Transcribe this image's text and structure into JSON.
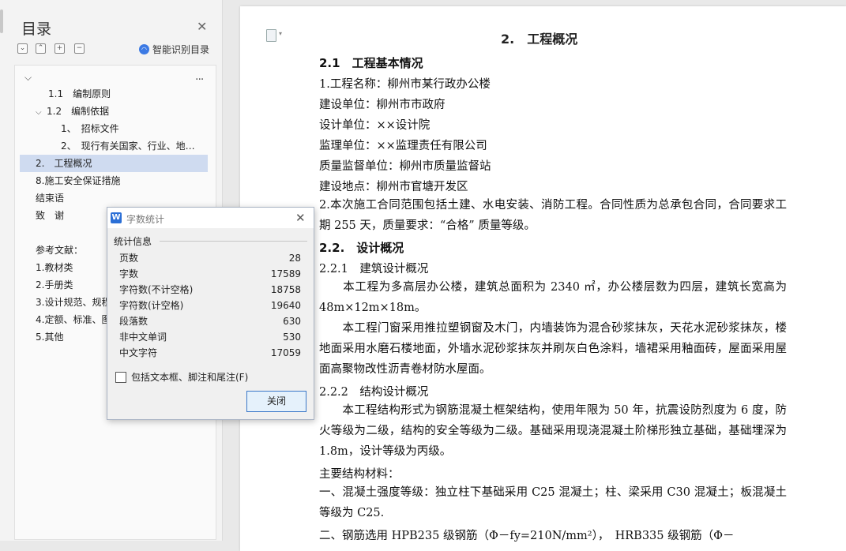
{
  "toc": {
    "title": "目录",
    "smart_label": "智能识别目录",
    "more": "...",
    "items": [
      {
        "label": "1.1　编制原则"
      },
      {
        "label": "1.2　编制依据"
      },
      {
        "label": "1、　招标文件"
      },
      {
        "label": "2、　现行有关国家、行业、地…"
      },
      {
        "label": "2.　工程概况"
      },
      {
        "label": "8.施工安全保证措施"
      },
      {
        "label": "结束语"
      },
      {
        "label": "致　谢"
      },
      {
        "label": "参考文献："
      },
      {
        "label": "1.教材类"
      },
      {
        "label": "2.手册类"
      },
      {
        "label": "3.设计规范、规程"
      },
      {
        "label": "4.定额、标准、图"
      },
      {
        "label": "5.其他"
      }
    ]
  },
  "document": {
    "title": "2.　工程概况",
    "lines": [
      "2.1　工程基本情况",
      "1.工程名称：柳州市某行政办公楼",
      "建设单位：柳州市市政府",
      "设计单位：××设计院",
      "监理单位：××监理责任有限公司",
      "质量监督单位：柳州市质量监督站",
      "建设地点：柳州市官塘开发区",
      "2.本次施工合同范围包括土建、水电安装、消防工程。合同性质为总承包合同，合同要求工期 255 天，质量要求：“合格” 质量等级。",
      "2.2.　设计概况",
      "2.2.1　建筑设计概况",
      "　　本工程为多高层办公楼，建筑总面积为 2340 ㎡，办公楼层数为四层，建筑长宽高为 48m×12m×18m。",
      "　　本工程门窗采用推拉塑钢窗及木门，内墙装饰为混合砂浆抹灰，天花水泥砂浆抹灰，楼地面采用水磨石楼地面，外墙水泥砂浆抹灰并刷灰白色涂料，墙裙采用釉面砖，屋面采用屋面高聚物改性沥青卷材防水屋面。",
      "2.2.2　结构设计概况",
      "　　本工程结构形式为钢筋混凝土框架结构，使用年限为 50 年，抗震设防烈度为 6 度，防火等级为二级，结构的安全等级为二级。基础采用现浇混凝土阶梯形独立基础，基础埋深为 1.8m，设计等级为丙级。",
      "主要结构材料：",
      "一、混凝土强度等级：独立柱下基础采用 C25 混凝土；柱、梁采用 C30 混凝土；板混凝土等级为 C25.",
      "二、钢筋选用 HPB235 级钢筋（Φ－fy=210N/mm²），　HRB335 级钢筋（Φ－"
    ]
  },
  "dialog": {
    "title": "字数统计",
    "group_label": "统计信息",
    "stats": [
      {
        "label": "页数",
        "value": "28"
      },
      {
        "label": "字数",
        "value": "17589"
      },
      {
        "label": "字符数(不计空格)",
        "value": "18758"
      },
      {
        "label": "字符数(计空格)",
        "value": "19640"
      },
      {
        "label": "段落数",
        "value": "630"
      },
      {
        "label": "非中文单词",
        "value": "530"
      },
      {
        "label": "中文字符",
        "value": "17059"
      }
    ],
    "checkbox_label": "包括文本框、脚注和尾注(F)",
    "close_label": "关闭"
  }
}
